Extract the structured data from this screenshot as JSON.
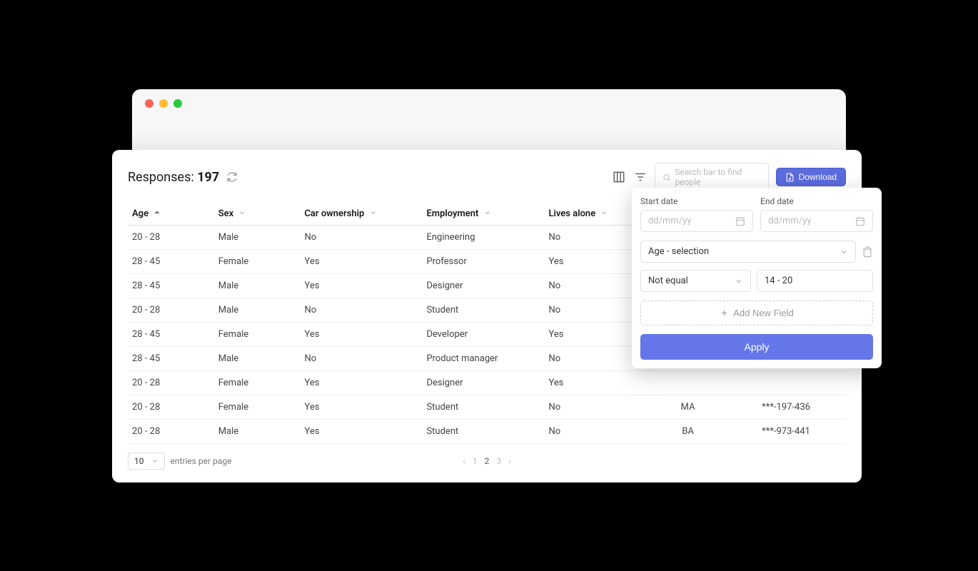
{
  "toolbar": {
    "responses_prefix": "Responses: ",
    "responses_count": "197",
    "search_placeholder": "Search bar to find people",
    "download_label": "Download"
  },
  "table": {
    "headers": {
      "age": "Age",
      "sex": "Sex",
      "car": "Car ownership",
      "employment": "Employment",
      "lives_alone": "Lives alone"
    },
    "rows": [
      {
        "age": "20 - 28",
        "sex": "Male",
        "car": "No",
        "employment": "Engineering",
        "alone": "No",
        "degree": "",
        "phone": ""
      },
      {
        "age": "28 - 45",
        "sex": "Female",
        "car": "Yes",
        "employment": "Professor",
        "alone": "Yes",
        "degree": "",
        "phone": ""
      },
      {
        "age": "28 - 45",
        "sex": "Male",
        "car": "Yes",
        "employment": "Designer",
        "alone": "No",
        "degree": "",
        "phone": ""
      },
      {
        "age": "20 - 28",
        "sex": "Male",
        "car": "No",
        "employment": "Student",
        "alone": "No",
        "degree": "",
        "phone": ""
      },
      {
        "age": "28 - 45",
        "sex": "Female",
        "car": "Yes",
        "employment": "Developer",
        "alone": "Yes",
        "degree": "",
        "phone": ""
      },
      {
        "age": "28 - 45",
        "sex": "Male",
        "car": "No",
        "employment": "Product manager",
        "alone": "No",
        "degree": "",
        "phone": ""
      },
      {
        "age": "20 - 28",
        "sex": "Female",
        "car": "Yes",
        "employment": "Designer",
        "alone": "Yes",
        "degree": "",
        "phone": ""
      },
      {
        "age": "20 - 28",
        "sex": "Female",
        "car": "Yes",
        "employment": "Student",
        "alone": "No",
        "degree": "MA",
        "phone": "***-197-436"
      },
      {
        "age": "20 - 28",
        "sex": "Male",
        "car": "Yes",
        "employment": "Student",
        "alone": "No",
        "degree": "BA",
        "phone": "***-973-441"
      }
    ]
  },
  "pagination": {
    "page_size": "10",
    "entries_label": "entries per page",
    "pages": [
      "1",
      "2",
      "3"
    ],
    "active_page": "2"
  },
  "filter": {
    "start_label": "Start date",
    "end_label": "End date",
    "date_placeholder": "dd/mm/yy",
    "field_value": "Age - selection",
    "operator_value": "Not equal",
    "range_value": "14 - 20",
    "add_field_label": "Add New Field",
    "apply_label": "Apply"
  }
}
